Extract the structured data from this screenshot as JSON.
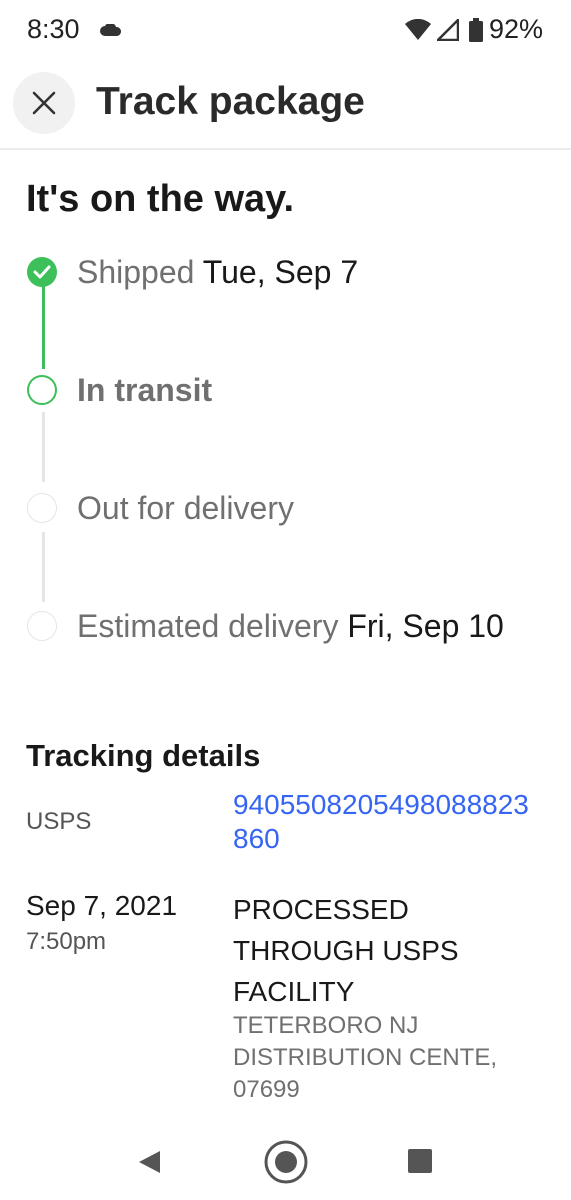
{
  "status_bar": {
    "time": "8:30",
    "battery_percent": "92%",
    "icons": [
      "cloud-icon",
      "wifi-icon",
      "signal-icon",
      "battery-icon"
    ]
  },
  "header": {
    "title": "Track package",
    "close_icon": "close-icon"
  },
  "headline": "It's on the way.",
  "timeline": {
    "accent_color": "#3dbf5a",
    "steps": [
      {
        "label": "Shipped",
        "date": "Tue, Sep 7",
        "state": "done"
      },
      {
        "label": "In transit",
        "date": "",
        "state": "current"
      },
      {
        "label": "Out for delivery",
        "date": "",
        "state": "pending"
      },
      {
        "label": "Estimated delivery",
        "date": "Fri, Sep 10",
        "state": "pending"
      }
    ]
  },
  "tracking": {
    "section_title": "Tracking details",
    "carrier": "USPS",
    "number": "9405508205498088823860",
    "link_color": "#3665f3",
    "events": [
      {
        "date": "Sep 7, 2021",
        "time": "7:50pm",
        "status": "PROCESSED THROUGH USPS FACILITY",
        "location": "TETERBORO NJ DISTRIBUTION CENTE, 07699"
      }
    ]
  },
  "nav_bar": {
    "icons": [
      "back-icon",
      "home-icon",
      "recents-icon"
    ]
  }
}
